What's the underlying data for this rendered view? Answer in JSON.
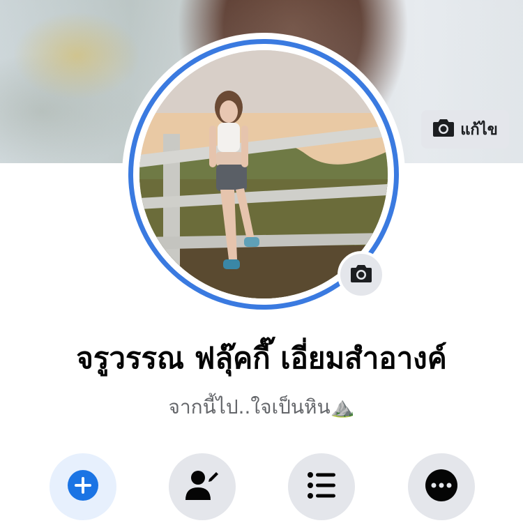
{
  "cover": {
    "edit_label": "แก้ไข",
    "edit_icon": "camera-icon"
  },
  "profile": {
    "name": "จรูวรรณ ฟลุ๊คกี๊ เอี่ยมสำอางค์",
    "bio": "จากนี้ไป..ใจเป็นหิน⛰️",
    "avatar_ring_color": "#3a7ae0",
    "avatar_camera_icon": "camera-icon"
  },
  "actions": [
    {
      "icon": "add-story-icon",
      "color": "#1b74e4"
    },
    {
      "icon": "edit-profile-icon",
      "color": "#050505"
    },
    {
      "icon": "activity-log-icon",
      "color": "#050505"
    },
    {
      "icon": "more-icon",
      "color": "#050505"
    }
  ]
}
